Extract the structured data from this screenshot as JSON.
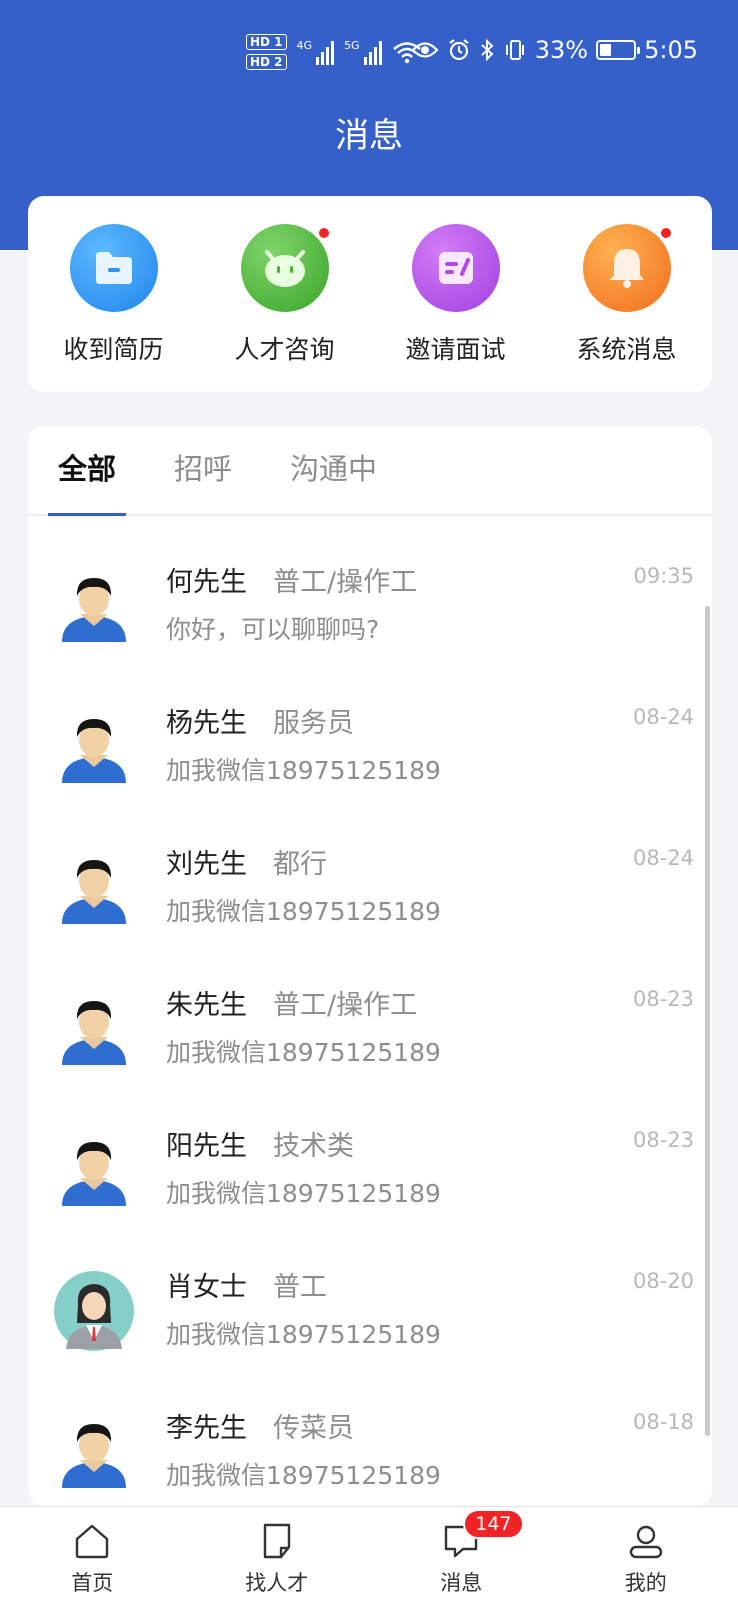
{
  "status_bar": {
    "hd1": "HD 1",
    "hd2": "HD 2",
    "net1": "4G",
    "net2": "5G",
    "battery_pct": "33%",
    "battery_level": 0.33,
    "time": "5:05"
  },
  "page_title": "消息",
  "quick_actions": [
    {
      "label": "收到简历",
      "icon": "folder-icon",
      "color": "#2f92ef",
      "dot": false
    },
    {
      "label": "人才咨询",
      "icon": "mascot-icon",
      "color": "#49b531",
      "dot": true
    },
    {
      "label": "邀请面试",
      "icon": "edit-note-icon",
      "color": "#b548e6",
      "dot": false
    },
    {
      "label": "系统消息",
      "icon": "bell-icon",
      "color": "#f48725",
      "dot": true
    }
  ],
  "tabs": [
    {
      "label": "全部",
      "active": true
    },
    {
      "label": "招呼",
      "active": false
    },
    {
      "label": "沟通中",
      "active": false
    }
  ],
  "messages": [
    {
      "name": "何先生",
      "job": "普工/操作工",
      "time": "09:35",
      "text": "你好，可以聊聊吗?",
      "avatar": "male"
    },
    {
      "name": "杨先生",
      "job": "服务员",
      "time": "08-24",
      "text": "加我微信18975125189",
      "avatar": "male"
    },
    {
      "name": "刘先生",
      "job": "都行",
      "time": "08-24",
      "text": "加我微信18975125189",
      "avatar": "male"
    },
    {
      "name": "朱先生",
      "job": "普工/操作工",
      "time": "08-23",
      "text": "加我微信18975125189",
      "avatar": "male"
    },
    {
      "name": "阳先生",
      "job": "技术类",
      "time": "08-23",
      "text": "加我微信18975125189",
      "avatar": "male"
    },
    {
      "name": "肖女士",
      "job": "普工",
      "time": "08-20",
      "text": "加我微信18975125189",
      "avatar": "female"
    },
    {
      "name": "李先生",
      "job": "传菜员",
      "time": "08-18",
      "text": "加我微信18975125189",
      "avatar": "male"
    }
  ],
  "tabbar": [
    {
      "label": "首页",
      "icon": "home-icon"
    },
    {
      "label": "找人才",
      "icon": "document-icon"
    },
    {
      "label": "消息",
      "icon": "chat-icon",
      "badge": "147"
    },
    {
      "label": "我的",
      "icon": "user-icon"
    }
  ],
  "colors": {
    "primary": "#3560c9",
    "badge": "#f02424"
  }
}
